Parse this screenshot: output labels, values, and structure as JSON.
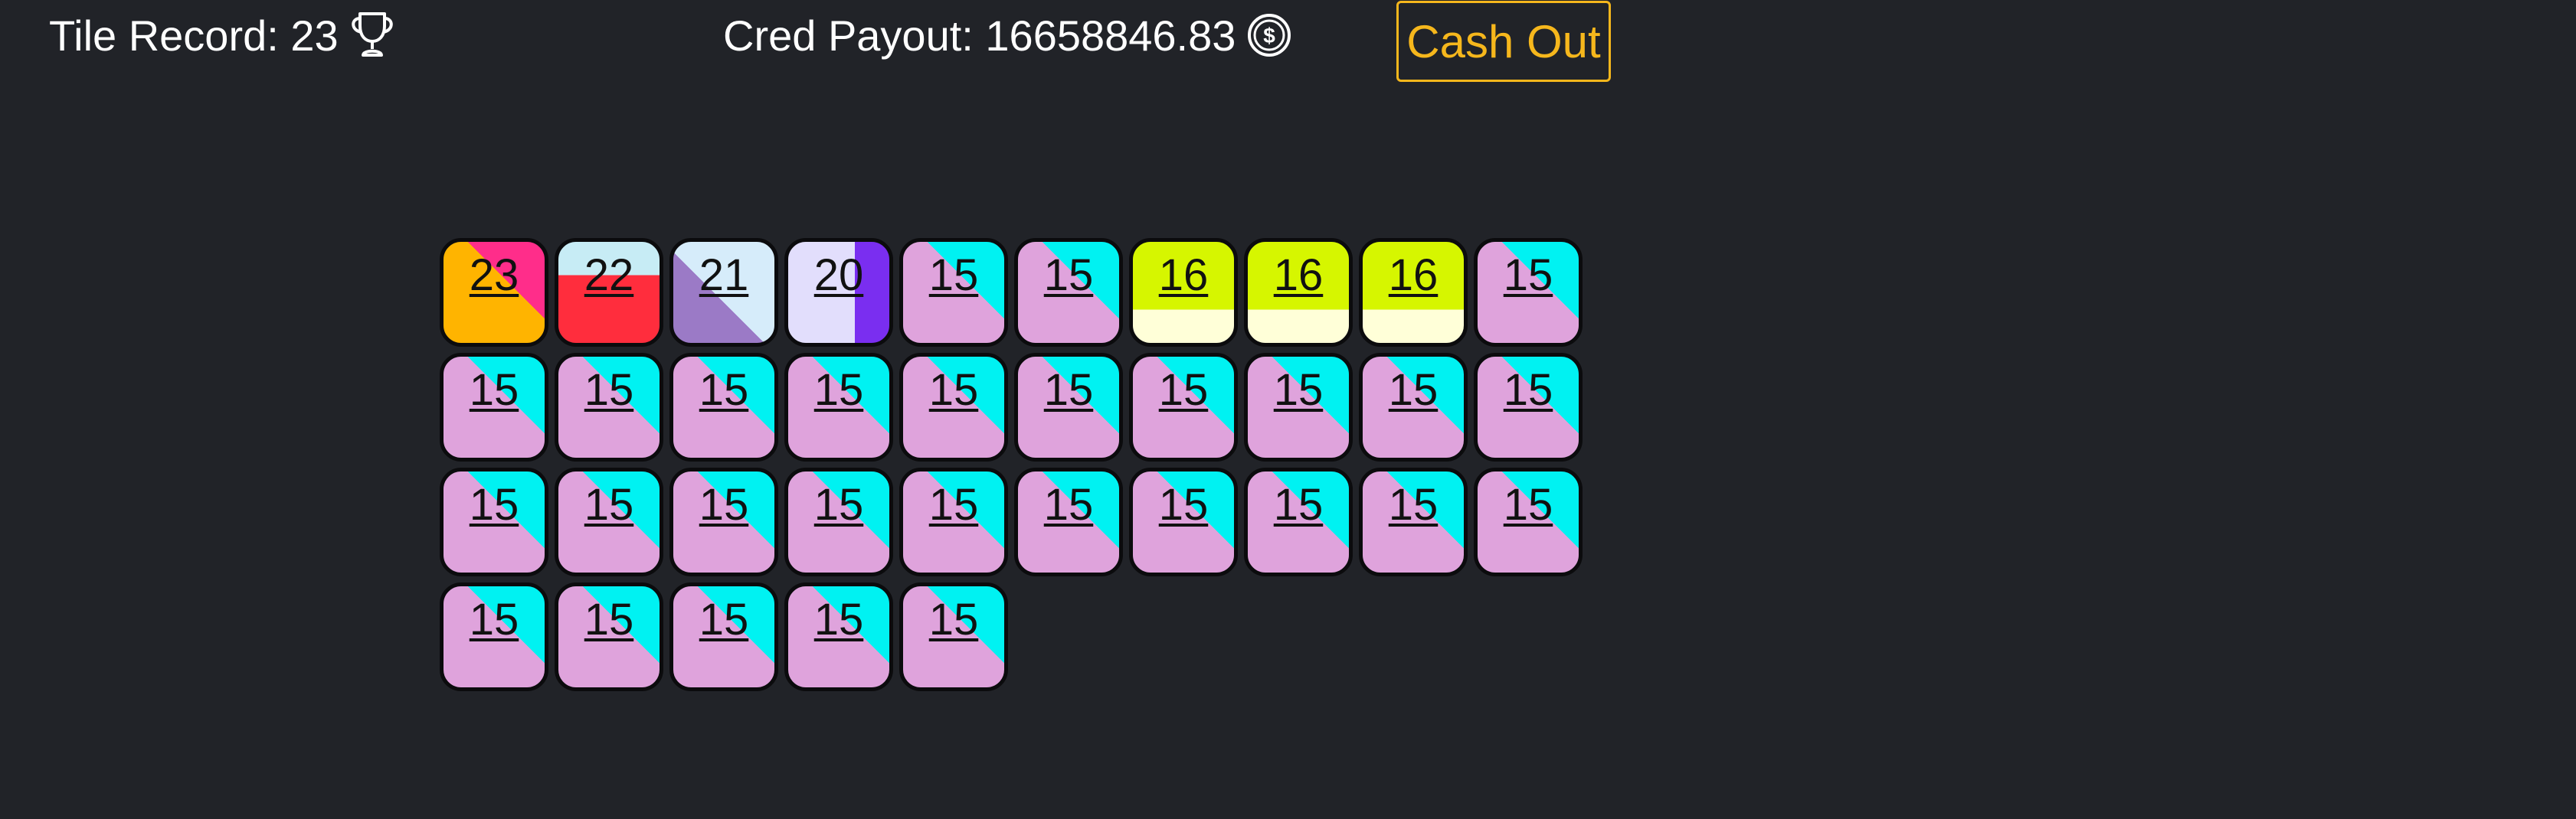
{
  "header": {
    "record_label": "Tile Record: 23",
    "record_icon": "trophy-icon",
    "payout_label": "Cred Payout: 16658846.83",
    "payout_icon": "dollar-coin-icon",
    "cashout_label": "Cash Out"
  },
  "colors": {
    "background": "#212328",
    "text": "#ffffff",
    "accent": "#f6b71c"
  },
  "board": {
    "columns": 10,
    "tiles": [
      {
        "value": "23",
        "pattern": "diag-tr",
        "base": "#ffb400",
        "accent": "#ff2d8a"
      },
      {
        "value": "22",
        "pattern": "top-band",
        "base": "#ff2d3d",
        "accent": "#c7ecf5"
      },
      {
        "value": "21",
        "pattern": "diag-bl",
        "base": "#d6ecfa",
        "accent": "#9b7ac6"
      },
      {
        "value": "20",
        "pattern": "right-band",
        "base": "#e2defc",
        "accent": "#7a2ef0"
      },
      {
        "value": "15",
        "pattern": "diag-tr",
        "base": "#dfa3dc",
        "accent": "#00f2f2"
      },
      {
        "value": "15",
        "pattern": "diag-tr",
        "base": "#dfa3dc",
        "accent": "#00f2f2"
      },
      {
        "value": "16",
        "pattern": "bottom-band",
        "base": "#d6f600",
        "accent": "#ffffd8"
      },
      {
        "value": "16",
        "pattern": "bottom-band",
        "base": "#d6f600",
        "accent": "#ffffd8"
      },
      {
        "value": "16",
        "pattern": "bottom-band",
        "base": "#d6f600",
        "accent": "#ffffd8"
      },
      {
        "value": "15",
        "pattern": "diag-tr",
        "base": "#dfa3dc",
        "accent": "#00f2f2"
      },
      {
        "value": "15",
        "pattern": "diag-tr",
        "base": "#dfa3dc",
        "accent": "#00f2f2"
      },
      {
        "value": "15",
        "pattern": "diag-tr",
        "base": "#dfa3dc",
        "accent": "#00f2f2"
      },
      {
        "value": "15",
        "pattern": "diag-tr",
        "base": "#dfa3dc",
        "accent": "#00f2f2"
      },
      {
        "value": "15",
        "pattern": "diag-tr",
        "base": "#dfa3dc",
        "accent": "#00f2f2"
      },
      {
        "value": "15",
        "pattern": "diag-tr",
        "base": "#dfa3dc",
        "accent": "#00f2f2"
      },
      {
        "value": "15",
        "pattern": "diag-tr",
        "base": "#dfa3dc",
        "accent": "#00f2f2"
      },
      {
        "value": "15",
        "pattern": "diag-tr",
        "base": "#dfa3dc",
        "accent": "#00f2f2"
      },
      {
        "value": "15",
        "pattern": "diag-tr",
        "base": "#dfa3dc",
        "accent": "#00f2f2"
      },
      {
        "value": "15",
        "pattern": "diag-tr",
        "base": "#dfa3dc",
        "accent": "#00f2f2"
      },
      {
        "value": "15",
        "pattern": "diag-tr",
        "base": "#dfa3dc",
        "accent": "#00f2f2"
      },
      {
        "value": "15",
        "pattern": "diag-tr",
        "base": "#dfa3dc",
        "accent": "#00f2f2"
      },
      {
        "value": "15",
        "pattern": "diag-tr",
        "base": "#dfa3dc",
        "accent": "#00f2f2"
      },
      {
        "value": "15",
        "pattern": "diag-tr",
        "base": "#dfa3dc",
        "accent": "#00f2f2"
      },
      {
        "value": "15",
        "pattern": "diag-tr",
        "base": "#dfa3dc",
        "accent": "#00f2f2"
      },
      {
        "value": "15",
        "pattern": "diag-tr",
        "base": "#dfa3dc",
        "accent": "#00f2f2"
      },
      {
        "value": "15",
        "pattern": "diag-tr",
        "base": "#dfa3dc",
        "accent": "#00f2f2"
      },
      {
        "value": "15",
        "pattern": "diag-tr",
        "base": "#dfa3dc",
        "accent": "#00f2f2"
      },
      {
        "value": "15",
        "pattern": "diag-tr",
        "base": "#dfa3dc",
        "accent": "#00f2f2"
      },
      {
        "value": "15",
        "pattern": "diag-tr",
        "base": "#dfa3dc",
        "accent": "#00f2f2"
      },
      {
        "value": "15",
        "pattern": "diag-tr",
        "base": "#dfa3dc",
        "accent": "#00f2f2"
      },
      {
        "value": "15",
        "pattern": "diag-tr",
        "base": "#dfa3dc",
        "accent": "#00f2f2"
      },
      {
        "value": "15",
        "pattern": "diag-tr",
        "base": "#dfa3dc",
        "accent": "#00f2f2"
      },
      {
        "value": "15",
        "pattern": "diag-tr",
        "base": "#dfa3dc",
        "accent": "#00f2f2"
      },
      {
        "value": "15",
        "pattern": "diag-tr",
        "base": "#dfa3dc",
        "accent": "#00f2f2"
      },
      {
        "value": "15",
        "pattern": "diag-tr",
        "base": "#dfa3dc",
        "accent": "#00f2f2"
      }
    ]
  }
}
